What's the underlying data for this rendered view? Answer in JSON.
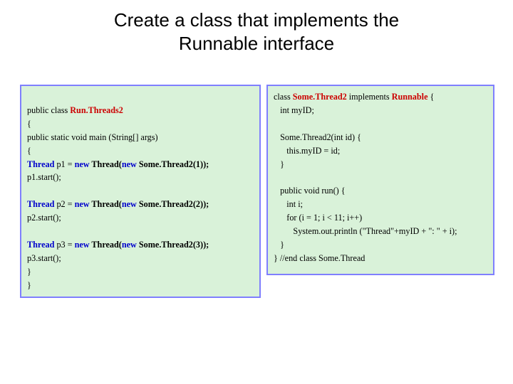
{
  "title_line1": "Create a class that implements the",
  "title_line2": "Runnable interface",
  "left": {
    "l1a": "public class ",
    "l1b": "Run.Threads2",
    "l2": "{",
    "l3": "public static void main (String[] args)",
    "l4": "{",
    "l5a": "Thread",
    "l5b": " p1 = ",
    "l5c": "new",
    "l5d": " Thread(",
    "l5e": "new",
    "l5f": " Some.Thread2(1));",
    "l6": "p1.start();",
    "blank": "",
    "l7a": "Thread",
    "l7b": " p2 = ",
    "l7c": "new",
    "l7d": " Thread(",
    "l7e": "new",
    "l7f": " Some.Thread2(2));",
    "l8": "p2.start();",
    "l9a": "Thread",
    "l9b": " p3 = ",
    "l9c": "new",
    "l9d": " Thread(",
    "l9e": "new",
    "l9f": " Some.Thread2(3));",
    "l10": "p3.start();",
    "l11": "}",
    "l12": "}"
  },
  "right": {
    "l1a": "class ",
    "l1b": "Some.Thread2",
    "l1c": " implements ",
    "l1d": "Runnable",
    "l1e": " {",
    "l2": "   int myID;",
    "blank": "",
    "l3": "   Some.Thread2(int id) {",
    "l4": "      this.myID = id;",
    "l5": "   }",
    "l6": "   public void run() {",
    "l7": "      int i;",
    "l8": "      for (i = 1; i < 11; i++)",
    "l9": "         System.out.println (\"Thread\"+myID + \": \" + i);",
    "l10": "   }",
    "l11": "} //end class Some.Thread"
  }
}
